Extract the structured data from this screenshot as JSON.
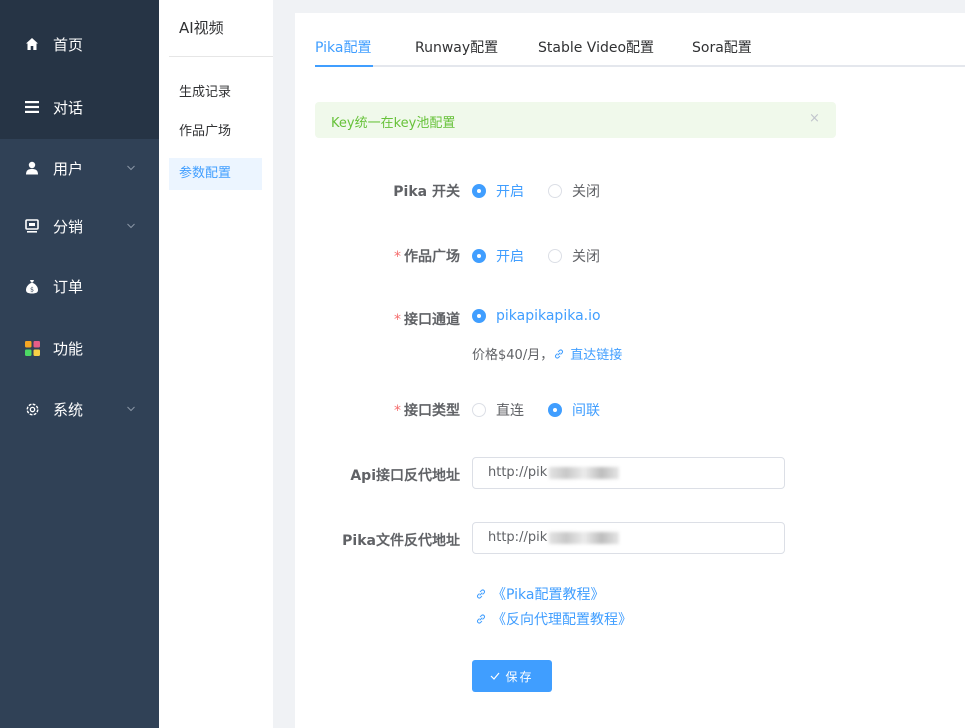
{
  "sidebar": {
    "items": [
      {
        "label": "首页",
        "icon": "home-icon"
      },
      {
        "label": "对话",
        "icon": "list-icon"
      },
      {
        "label": "用户",
        "icon": "user-icon"
      },
      {
        "label": "分销",
        "icon": "monitor-icon"
      },
      {
        "label": "订单",
        "icon": "money-bag-icon"
      },
      {
        "label": "功能",
        "icon": "grid-icon"
      },
      {
        "label": "系统",
        "icon": "gear-icon"
      }
    ]
  },
  "subnav": {
    "title": "AI视频",
    "items": [
      "生成记录",
      "作品广场",
      "参数配置"
    ]
  },
  "tabs": [
    "Pika配置",
    "Runway配置",
    "Stable Video配置",
    "Sora配置"
  ],
  "alert": {
    "text": "Key统一在key池配置",
    "close": "×"
  },
  "form": {
    "pika_switch": {
      "label": "Pika 开关",
      "options": [
        "开启",
        "关闭"
      ],
      "selected": "开启"
    },
    "gallery": {
      "label": "作品广场",
      "options": [
        "开启",
        "关闭"
      ],
      "selected": "开启"
    },
    "channel": {
      "label": "接口通道",
      "option": "pikapikapika.io",
      "price": "价格$40/月，",
      "link": "直达链接"
    },
    "api_type": {
      "label": "接口类型",
      "options": [
        "直连",
        "间联"
      ],
      "selected": "间联"
    },
    "api_proxy": {
      "label": "Api接口反代地址",
      "value": "http://pik"
    },
    "file_proxy": {
      "label": "Pika文件反代地址",
      "value": "http://pik"
    }
  },
  "docs": [
    "《Pika配置教程》",
    "《反向代理配置教程》"
  ],
  "save_label": "保存",
  "colors": {
    "primary": "#409eff",
    "sidebar": "#304156",
    "danger": "#f56c6c",
    "success": "#67c23a"
  }
}
